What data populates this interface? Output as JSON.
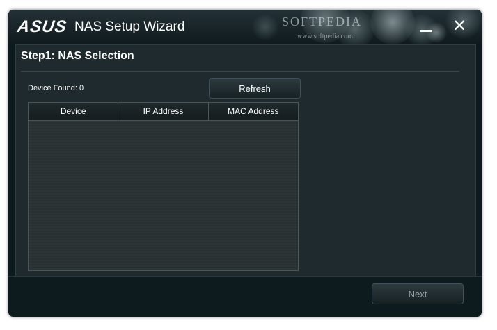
{
  "window": {
    "logo": "ASUS",
    "title": "NAS Setup Wizard",
    "watermark": "SOFTPEDIA",
    "watermark_url": "www.softpedia.com"
  },
  "step": {
    "title": "Step1: NAS Selection"
  },
  "device_found": "Device Found: 0",
  "refresh_label": "Refresh",
  "table": {
    "columns": [
      "Device",
      "IP Address",
      "MAC Address"
    ],
    "rows": []
  },
  "next_label": "Next",
  "controls": {
    "close_glyph": "✕"
  },
  "icons": {
    "minimize": "minimize-icon",
    "close": "close-icon"
  }
}
